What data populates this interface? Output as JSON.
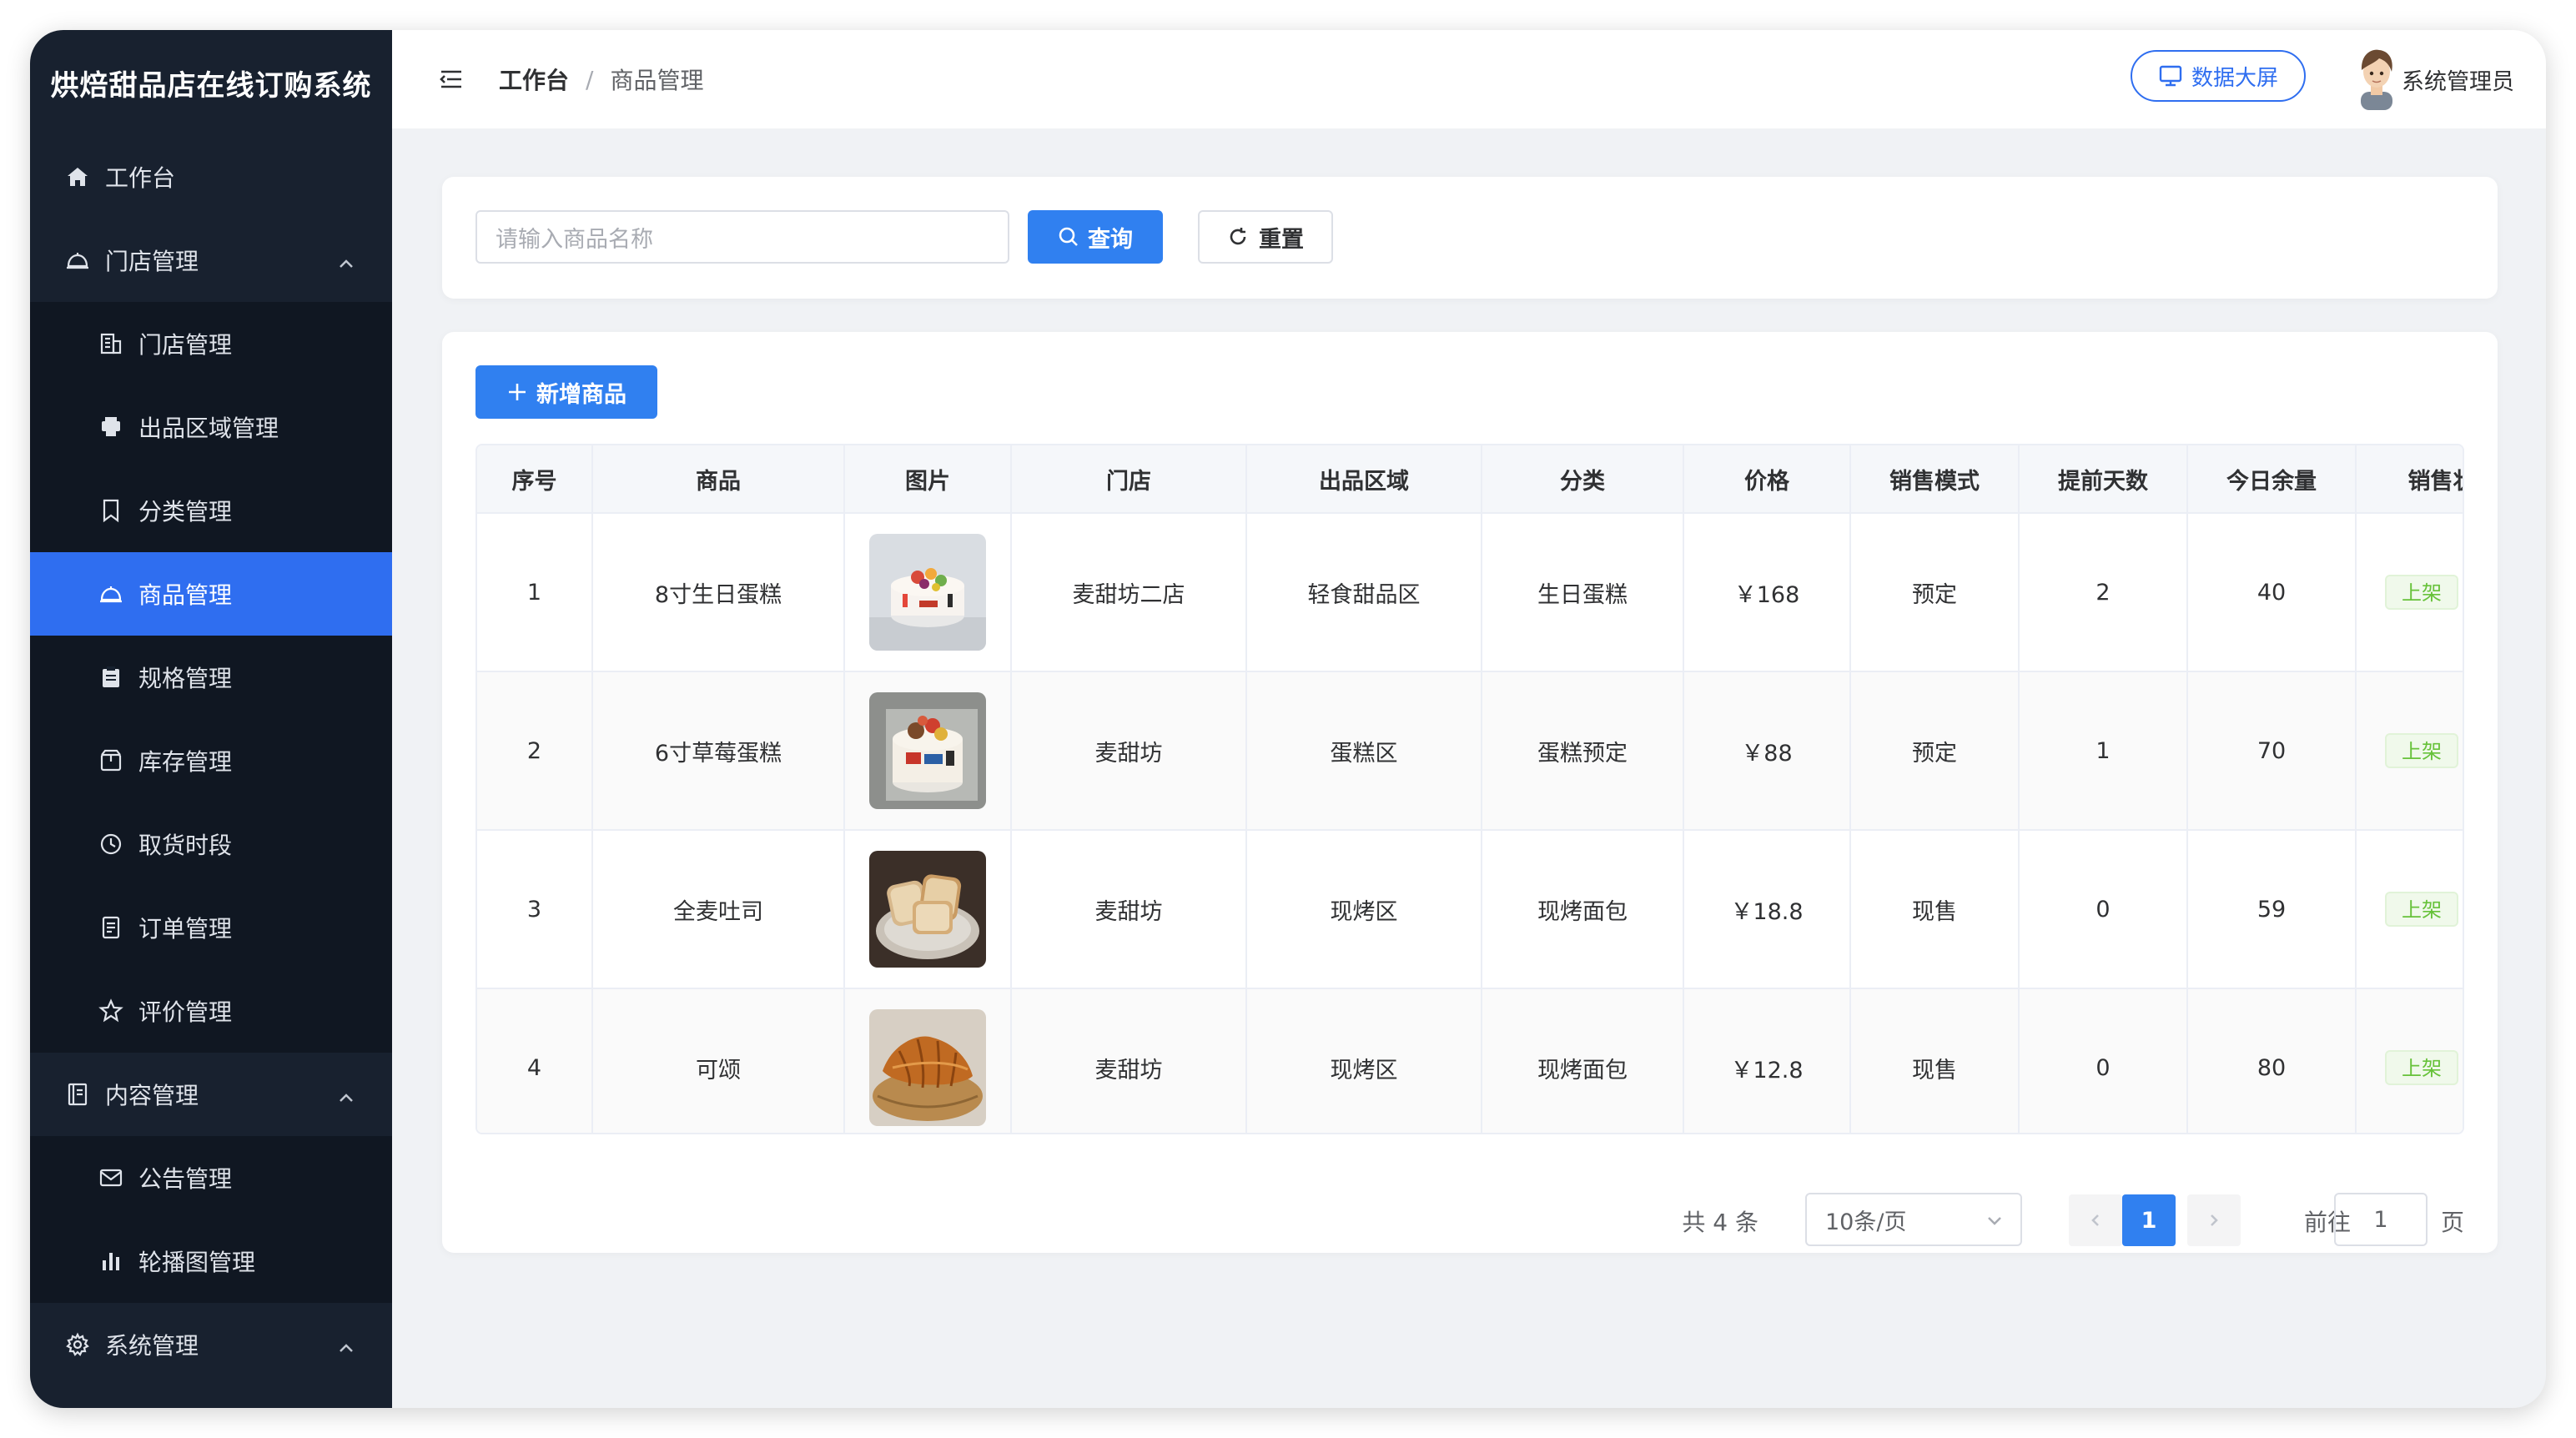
{
  "app": {
    "title": "烘焙甜品店在线订购系统"
  },
  "sidebar": {
    "items": [
      {
        "label": "工作台",
        "icon": "home-icon",
        "level": "top"
      },
      {
        "label": "门店管理",
        "icon": "cloche-icon",
        "level": "top",
        "expanded": true
      },
      {
        "label": "门店管理",
        "icon": "building-icon",
        "level": "sub"
      },
      {
        "label": "出品区域管理",
        "icon": "printer-icon",
        "level": "sub"
      },
      {
        "label": "分类管理",
        "icon": "bookmark-icon",
        "level": "sub"
      },
      {
        "label": "商品管理",
        "icon": "cloche-icon",
        "level": "sub",
        "active": true
      },
      {
        "label": "规格管理",
        "icon": "clipboard-icon",
        "level": "sub"
      },
      {
        "label": "库存管理",
        "icon": "box-icon",
        "level": "sub"
      },
      {
        "label": "取货时段",
        "icon": "clock-icon",
        "level": "sub"
      },
      {
        "label": "订单管理",
        "icon": "document-icon",
        "level": "sub"
      },
      {
        "label": "评价管理",
        "icon": "star-icon",
        "level": "sub"
      },
      {
        "label": "内容管理",
        "icon": "notebook-icon",
        "level": "top",
        "expanded": true
      },
      {
        "label": "公告管理",
        "icon": "mail-icon",
        "level": "sub"
      },
      {
        "label": "轮播图管理",
        "icon": "bar-chart-icon",
        "level": "sub"
      },
      {
        "label": "系统管理",
        "icon": "gear-icon",
        "level": "top",
        "expanded": true
      }
    ]
  },
  "header": {
    "breadcrumb": {
      "home": "工作台",
      "separator": "/",
      "current": "商品管理"
    },
    "bigscreen_label": "数据大屏",
    "username": "系统管理员"
  },
  "search": {
    "placeholder": "请输入商品名称",
    "query_label": "查询",
    "reset_label": "重置"
  },
  "toolbar": {
    "add_label": "新增商品"
  },
  "table": {
    "columns": [
      "序号",
      "商品",
      "图片",
      "门店",
      "出品区域",
      "分类",
      "价格",
      "销售模式",
      "提前天数",
      "今日余量",
      "销售状态"
    ],
    "rows": [
      {
        "index": "1",
        "name": "8寸生日蛋糕",
        "image": "birthday-cake",
        "store": "麦甜坊二店",
        "area": "轻食甜品区",
        "category": "生日蛋糕",
        "price": "￥168",
        "mode": "预定",
        "days": "2",
        "stock": "40",
        "status": "上架"
      },
      {
        "index": "2",
        "name": "6寸草莓蛋糕",
        "image": "strawberry-cake",
        "store": "麦甜坊",
        "area": "蛋糕区",
        "category": "蛋糕预定",
        "price": "￥88",
        "mode": "预定",
        "days": "1",
        "stock": "70",
        "status": "上架"
      },
      {
        "index": "3",
        "name": "全麦吐司",
        "image": "toast",
        "store": "麦甜坊",
        "area": "现烤区",
        "category": "现烤面包",
        "price": "￥18.8",
        "mode": "现售",
        "days": "0",
        "stock": "59",
        "status": "上架"
      },
      {
        "index": "4",
        "name": "可颂",
        "image": "croissant",
        "store": "麦甜坊",
        "area": "现烤区",
        "category": "现烤面包",
        "price": "￥12.8",
        "mode": "现售",
        "days": "0",
        "stock": "80",
        "status": "上架"
      }
    ]
  },
  "pagination": {
    "total_text": "共 4 条",
    "page_size": "10条/页",
    "current_page": "1",
    "goto_label": "前往",
    "goto_value": "1",
    "page_suffix": "页"
  },
  "colors": {
    "primary": "#3080f0",
    "sidebar_bg": "#18212f",
    "sidebar_active": "#2f6ef0",
    "tag_green": "#67c23a"
  }
}
